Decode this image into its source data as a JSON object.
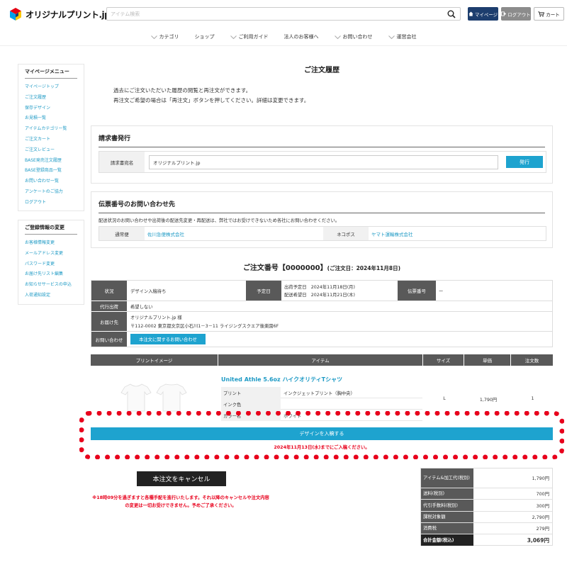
{
  "brand": {
    "name": "オリジナルプリント.jp",
    "logo_colors": [
      "#e60012",
      "#fcc800",
      "#00a0e9",
      "#1d3e6e"
    ]
  },
  "header": {
    "search_placeholder": "アイテム検索",
    "mypage_label": "マイページ",
    "logout_label": "ログアウト",
    "cart_label": "カート"
  },
  "gnav": [
    {
      "label": "カテゴリ",
      "icon": "chevron-down-icon"
    },
    {
      "label": "ショップ",
      "icon": ""
    },
    {
      "label": "ご利用ガイド",
      "icon": "chevron-down-icon"
    },
    {
      "label": "法人のお客様へ",
      "icon": ""
    },
    {
      "label": "お問い合わせ",
      "icon": "chevron-down-icon"
    },
    {
      "label": "運営会社",
      "icon": "chevron-down-icon"
    }
  ],
  "sidebar": {
    "mypage_title": "マイページメニュー",
    "mypage_items": [
      "マイページトップ",
      "ご注文履歴",
      "保存デザイン",
      "お見積一覧",
      "アイテムカテゴリー覧",
      "ご注文カート",
      "ご注文レビュー",
      "BASE発売注文履歴",
      "BASE登録商品一覧",
      "お問い合わせ一覧",
      "アンケートのご協力",
      "ログアウト"
    ],
    "account_title": "ご登録情報の変更",
    "account_items": [
      "お客様情報変更",
      "メールアドレス変更",
      "パスワード変更",
      "お届け先リスト編集",
      "お知らせサービスの申込",
      "入荷通知設定"
    ]
  },
  "page": {
    "title": "ご注文履歴",
    "intro_line1": "過去にご注文いただいた履歴の閲覧と再注文ができます。",
    "intro_line2": "再注文ご希望の場合は「再注文」ボタンを押してください。詳細は変更できます。"
  },
  "invoice": {
    "title": "請求書発行",
    "label": "請求書宛名",
    "value": "オリジナルプリント.jp",
    "button": "発行"
  },
  "contact": {
    "title": "伝票番号のお問い合わせ先",
    "note": "配送状況のお問い合わせや出荷後の配送先変更・再配送は、弊社ではお受けできないため各社にお問い合わせください。",
    "carriers": [
      {
        "label": "通常便",
        "value": "佐川急便株式会社"
      },
      {
        "label": "ネコポス",
        "value": "ヤマト運輸株式会社"
      }
    ]
  },
  "order": {
    "heading": "ご注文番号【0000000】",
    "date": "(ご注文日：2024年11月8日)",
    "status_label": "状況",
    "status_value": "デザイン入稿待ち",
    "schedule_label": "予定日",
    "ship_date": "出荷予定日　2024年11月18日(月)",
    "delivery_date": "配送希望日　2024年11月21日(木)",
    "tracking_label": "伝票番号",
    "tracking_value": "ー",
    "cod_label": "代行出荷",
    "cod_value": "希望しない",
    "dest_label": "お届け先",
    "dest_name": "オリジナルプリント.jp 様",
    "dest_address": "〒112-0002 東京都文京区小石川1－3－11 ライジングスクエア後楽園6F",
    "inquiry_label": "お問い合わせ",
    "inquiry_button": "本注文に関するお問い合わせ"
  },
  "items": {
    "headers": [
      "プリントイメージ",
      "アイテム",
      "サイズ",
      "単価",
      "注文数"
    ],
    "rows": [
      {
        "name": "United Athle 5.6oz ハイクオリティTシャツ",
        "print_label": "プリント",
        "print_value": "インクジェットプリント（胸中央）",
        "ink_label": "インク色",
        "ink_value": "",
        "color_label": "カラー名",
        "color_value": "ホワイト",
        "size": "L",
        "unit_price": "1,790円",
        "qty": "1"
      }
    ]
  },
  "upload": {
    "button": "デザインを入稿する",
    "note": "2024年11月13日(水)までにご入稿ください。"
  },
  "cancel": {
    "button": "本注文をキャンセル",
    "note_line1": "※18時09分を過ぎますと各種手配を進行いたします。それ以降のキャンセルや注文内容",
    "note_line2": "の変更は一切お受けできません。予めご了承ください。"
  },
  "summary": [
    {
      "label": "アイテム&加工代(税別)",
      "value": "1,790円"
    },
    {
      "label": "送料(税別)",
      "value": "700円"
    },
    {
      "label": "代引手数料(税別)",
      "value": "300円"
    },
    {
      "label": "課税対象額",
      "value": "2,790円"
    },
    {
      "label": "消費税",
      "value": "279円"
    },
    {
      "label": "合計金額(税込)",
      "value": "3,069円"
    }
  ],
  "colors": {
    "accent": "#1ea3cf",
    "navy": "#1d3e6e",
    "alert": "#e8001c",
    "table_head": "#595959"
  }
}
